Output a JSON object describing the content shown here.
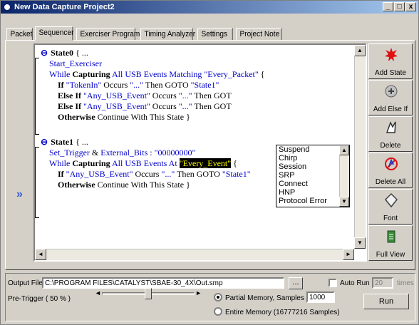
{
  "window": {
    "title": "New Data Capture Project2",
    "controls": [
      "_",
      "□",
      "x"
    ]
  },
  "tabs": [
    {
      "label": "Packet"
    },
    {
      "label": "Sequencer"
    },
    {
      "label": "Exerciser Program"
    },
    {
      "label": "Timing Analyzer"
    },
    {
      "label": "Settings"
    },
    {
      "label": "Project Note"
    }
  ],
  "active_tab": "Sequencer",
  "editor": {
    "state0": {
      "header_kw": "State0",
      "header_rest": " { ...",
      "start": "Start_Exerciser",
      "while": {
        "kw": "While ",
        "cap": "Capturing",
        "mid": " All USB Events Matching ",
        "name": "\"Every_Packet\"",
        "tail": " {"
      },
      "if1": {
        "kw": "If ",
        "arg": "\"TokenIn\"",
        "mid": " Occurs ",
        "dots": "\"...\"",
        "then": " Then GOTO ",
        "target": "\"State1\""
      },
      "elif1": {
        "kw": "Else If ",
        "arg": "\"Any_USB_Event\"",
        "mid": " Occurs ",
        "dots": "\"...\"",
        "then": " Then GOT"
      },
      "elif2": {
        "kw": "Else If ",
        "arg": "\"Any_USB_Event\"",
        "mid": " Occurs ",
        "dots": "\"...\"",
        "then": " Then GOT"
      },
      "otherwise": {
        "kw": "Otherwise",
        "rest": " Continue With This State }"
      }
    },
    "state1": {
      "header_kw": "State1",
      "header_rest": " { ...",
      "trigger": {
        "name": "Set_Trigger",
        "amp": " & ",
        "ext": "External_Bits",
        "colon": " : ",
        "val": "\"00000000\""
      },
      "while": {
        "kw": "While ",
        "cap": "Capturing",
        "mid": " All USB Events At ",
        "name": "\"Every_Event\"",
        "tail": " {"
      },
      "if1": {
        "kw": "If ",
        "arg": "\"Any_USB_Event\"",
        "mid": " Occurs ",
        "dots": "\"...\"",
        "then": " Then GOTO ",
        "target": "\"State1\""
      },
      "otherwise": {
        "kw": "Otherwise",
        "rest": " Continue With This State }"
      }
    },
    "dropdown_items": [
      "Suspend",
      "Chirp",
      "Session",
      "SRP",
      "Connect",
      "HNP",
      "Protocol Error"
    ]
  },
  "sidebar": [
    {
      "label": "Add State",
      "icon": "starburst-icon"
    },
    {
      "label": "Add Else If",
      "icon": "add-else-if-icon"
    },
    {
      "label": "Delete",
      "icon": "delete-icon"
    },
    {
      "label": "Delete All",
      "icon": "delete-all-icon"
    },
    {
      "label": "Font",
      "icon": "font-icon"
    },
    {
      "label": "Full View",
      "icon": "full-view-icon"
    }
  ],
  "bottom": {
    "output_file_label": "Output File",
    "output_file_value": "C:\\PROGRAM FILES\\CATALYST\\SBAE-30_4X\\Out.smp",
    "browse_label": "...",
    "auto_run_label": "Auto Run",
    "auto_run_value": "20",
    "auto_run_unit": "times",
    "pretrigger_label": "Pre-Trigger ( 50 % )",
    "pretrigger_percent": 50,
    "partial_memory_label": "Partial Memory, Samples No",
    "samples_value": "1000",
    "entire_memory_label": "Entire Memory (16777216 Samples)",
    "run_label": "Run"
  },
  "colors": {
    "keyword_blue": "#0000cc",
    "highlight_bg": "#000000",
    "highlight_fg": "#ffff00",
    "title_bar": "#0a246a"
  }
}
